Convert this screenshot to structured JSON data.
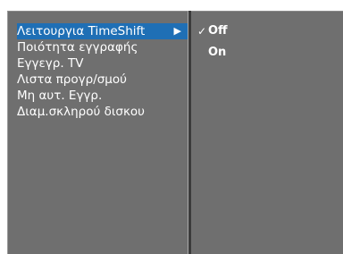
{
  "menu": {
    "items": [
      {
        "label": "Λειτουργια TimeShift"
      },
      {
        "label": "Ποιότητα εγγραφής"
      },
      {
        "label": "Εγγεγρ. TV"
      },
      {
        "label": "Λιστα προγρ/σμού"
      },
      {
        "label": "Μη αυτ. Εγγρ."
      },
      {
        "label": "Διαμ.σκληρού δισκου"
      }
    ],
    "submenu_arrow": "▶"
  },
  "submenu": {
    "options": [
      {
        "label": "Off",
        "checked": true
      },
      {
        "label": "On",
        "checked": false
      }
    ],
    "check_mark": "✓"
  },
  "colors": {
    "panel": "#6f6f6f",
    "highlight": "#1f6fb5",
    "divider": "#3b3b3b",
    "text": "#ffffff"
  }
}
